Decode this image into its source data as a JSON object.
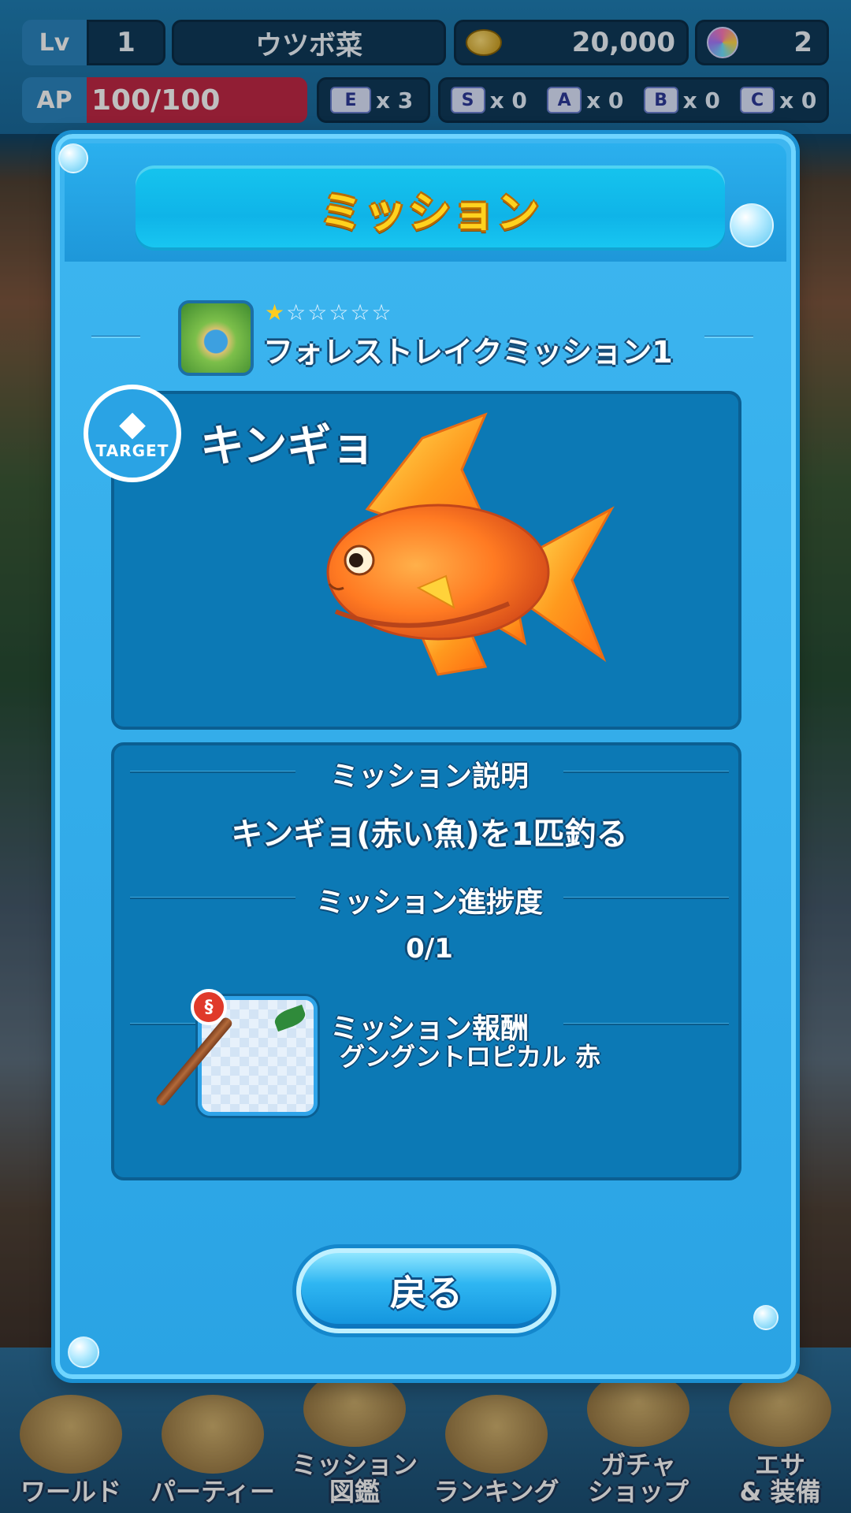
{
  "status": {
    "lv_label": "Lv",
    "level": "1",
    "player_name": "ウツボ菜",
    "coins": "20,000",
    "gems": "2",
    "ap_label": "AP",
    "ap_value": "100/100",
    "ticket_count": "x 3",
    "tickets": [
      {
        "rank": "S",
        "count": "x 0"
      },
      {
        "rank": "A",
        "count": "x 0"
      },
      {
        "rank": "B",
        "count": "x 0"
      },
      {
        "rank": "C",
        "count": "x 0"
      }
    ],
    "ap_fill": 1.0
  },
  "modal": {
    "title": "ミッション",
    "stage": {
      "name": "フォレストレイクミッション1",
      "stars_total": 6,
      "stars_filled": 1,
      "thumb_icon": "lake-stage-thumbnail"
    },
    "target": {
      "badge_text": "TARGET",
      "fish_name": "キンギョ",
      "fish_icon": "goldfish-illustration"
    },
    "description": {
      "heading": "ミッション説明",
      "text": "キンギョ(赤い魚)を1匹釣る"
    },
    "progress": {
      "heading": "ミッション進捗度",
      "value": "0/1"
    },
    "reward": {
      "heading": "ミッション報酬",
      "item_name": "グングントロピカル 赤",
      "item_icon": "fishing-rod-icon"
    },
    "back_label": "戻る"
  },
  "nav": [
    {
      "label": "ワールド",
      "icon": "ship-wheel-icon"
    },
    {
      "label": "パーティー",
      "icon": "handshake-icon"
    },
    {
      "label": "ミッション\n図鑑",
      "icon": "book-icon"
    },
    {
      "label": "ランキング",
      "icon": "crown-icon"
    },
    {
      "label": "ガチャ\nショップ",
      "icon": "gacha-basket-icon"
    },
    {
      "label": "エサ\n& 装備",
      "icon": "bait-bucket-icon"
    }
  ],
  "colors": {
    "accent_title": "#ffd21f",
    "panel": "#0c79b5",
    "modal": "#2aa3e4",
    "ap_bar": "#c22846"
  }
}
